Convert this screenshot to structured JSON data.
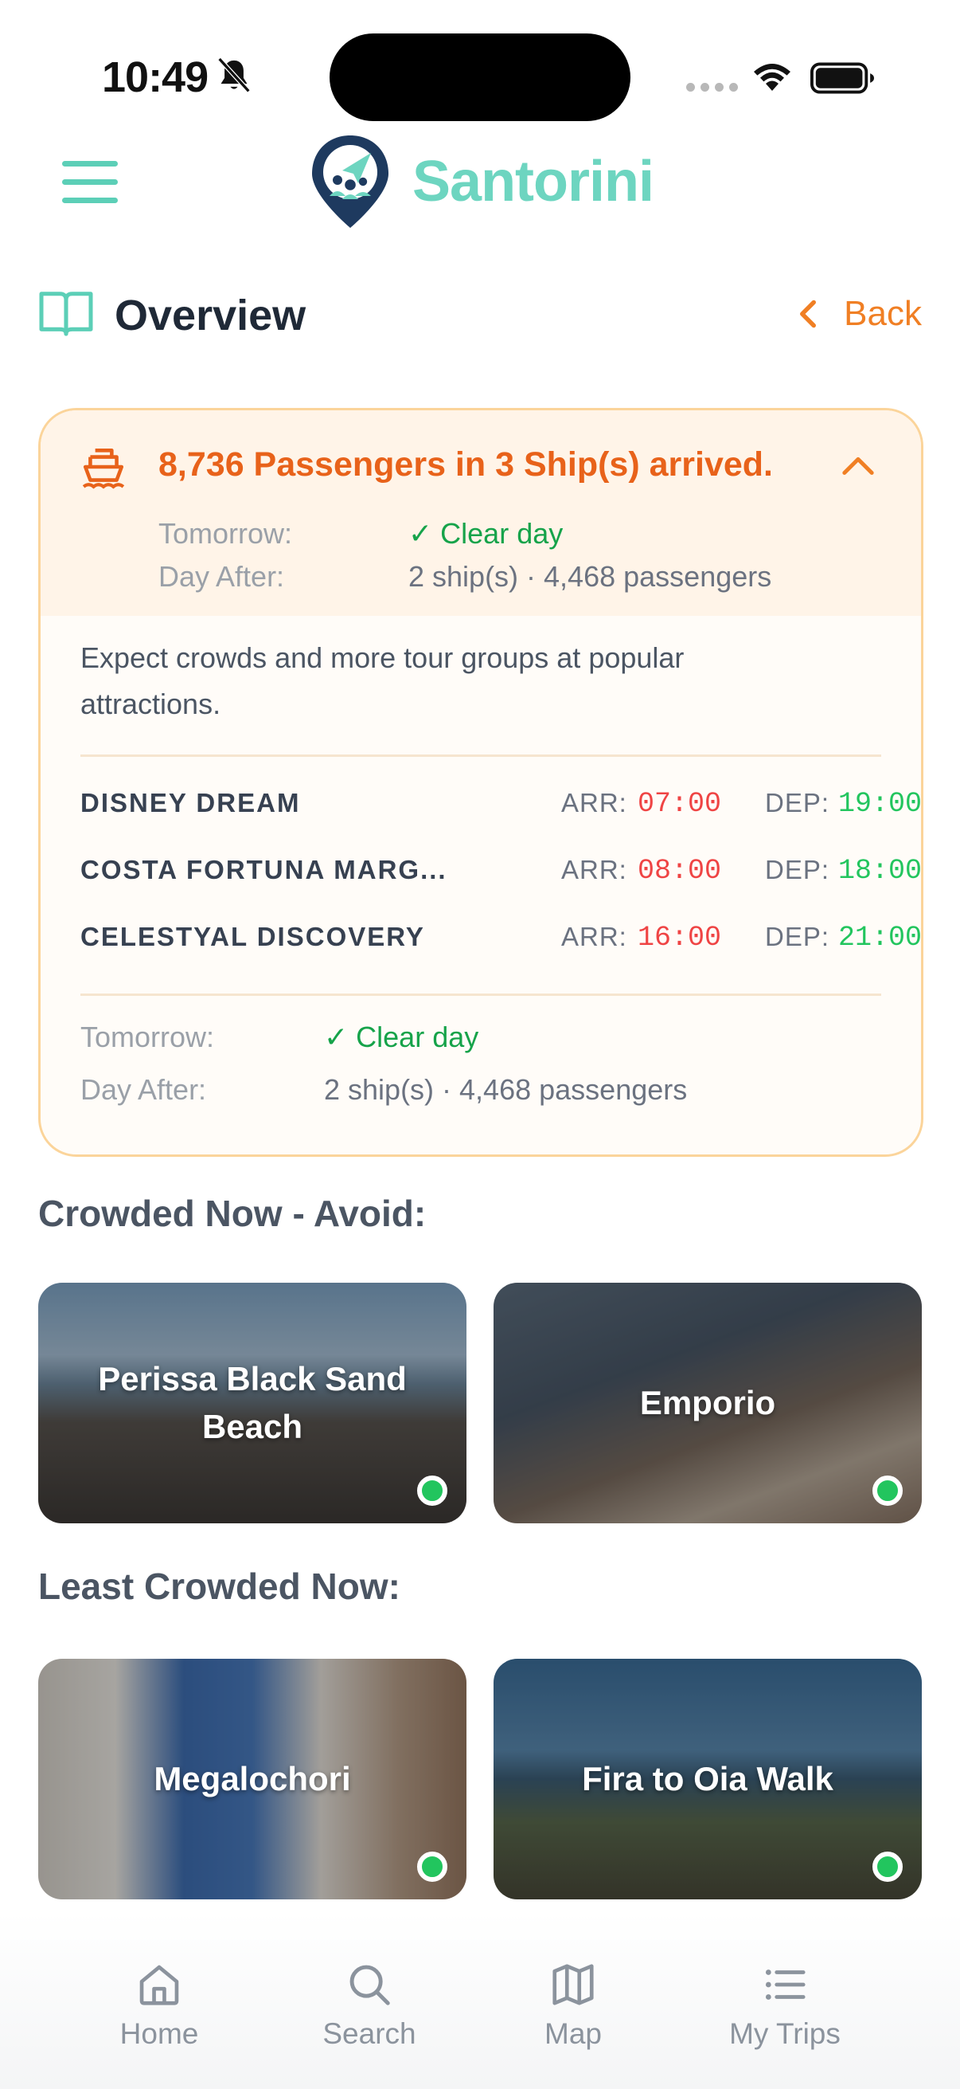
{
  "status_bar": {
    "time": "10:49"
  },
  "header": {
    "app_name": "Santorini"
  },
  "section": {
    "title": "Overview",
    "back_label": "Back"
  },
  "cruise_card": {
    "headline": "8,736 Passengers in 3 Ship(s) arrived.",
    "summary": {
      "tomorrow_label": "Tomorrow:",
      "tomorrow_value": "✓ Clear day",
      "day_after_label": "Day After:",
      "day_after_value": "2 ship(s) · 4,468 passengers"
    },
    "description": "Expect crowds and more tour groups at popular attractions.",
    "ships": [
      {
        "name": "DISNEY DREAM",
        "arr_label": "ARR:",
        "arr": "07:00",
        "dep_label": "DEP:",
        "dep": "19:00"
      },
      {
        "name": "COSTA FORTUNA MARG...",
        "arr_label": "ARR:",
        "arr": "08:00",
        "dep_label": "DEP:",
        "dep": "18:00"
      },
      {
        "name": "CELESTYAL DISCOVERY",
        "arr_label": "ARR:",
        "arr": "16:00",
        "dep_label": "DEP:",
        "dep": "21:00"
      }
    ],
    "footer": {
      "tomorrow_label": "Tomorrow:",
      "tomorrow_value": "✓ Clear day",
      "day_after_label": "Day After:",
      "day_after_value": "2 ship(s) · 4,468 passengers"
    },
    "colors": {
      "accent": "#e8621a",
      "border": "#fbd49a",
      "clear": "#16a34a",
      "arr": "#ef4444",
      "dep": "#22c55e"
    }
  },
  "crowded": {
    "title": "Crowded Now - Avoid:",
    "places": [
      {
        "name": "Perissa Black Sand Beach"
      },
      {
        "name": "Emporio"
      }
    ]
  },
  "least_crowded": {
    "title": "Least Crowded Now:",
    "places": [
      {
        "name": "Megalochori"
      },
      {
        "name": "Fira to Oia Walk"
      }
    ]
  },
  "nav": {
    "items": [
      {
        "label": "Home",
        "icon": "home-icon"
      },
      {
        "label": "Search",
        "icon": "search-icon"
      },
      {
        "label": "Map",
        "icon": "map-icon"
      },
      {
        "label": "My Trips",
        "icon": "list-icon"
      }
    ]
  },
  "theme": {
    "brand": "#6dd5c0",
    "brand_dark": "#1e3a5f",
    "back": "#f07f24"
  }
}
